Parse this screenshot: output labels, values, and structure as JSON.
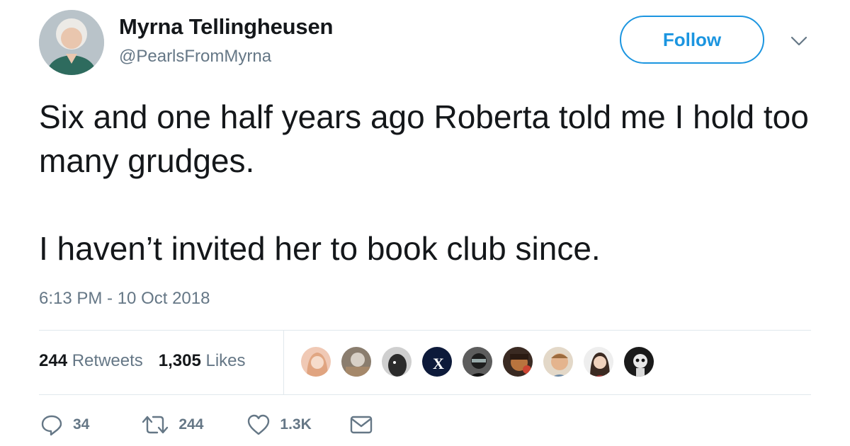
{
  "tweet": {
    "author": {
      "display_name": "Myrna Tellingheusen",
      "handle": "@PearlsFromMyrna"
    },
    "follow_label": "Follow",
    "text_paragraphs": [
      "Six and one half years ago Roberta told me I hold too many grudges.",
      "I haven’t invited her to book club since."
    ],
    "timestamp": "6:13 PM - 10 Oct 2018",
    "stats": {
      "retweets_count": "244",
      "retweets_label": "Retweets",
      "likes_count": "1,305",
      "likes_label": "Likes"
    },
    "actions": {
      "reply_count": "34",
      "retweet_count": "244",
      "like_count": "1.3K"
    }
  },
  "colors": {
    "accent": "#1b95e0",
    "text": "#14171a",
    "secondary": "#657786",
    "divider": "#e1e8ed"
  },
  "icons": [
    "avatar",
    "chevron-down-icon",
    "reply-icon",
    "retweet-icon",
    "heart-icon",
    "envelope-icon"
  ]
}
